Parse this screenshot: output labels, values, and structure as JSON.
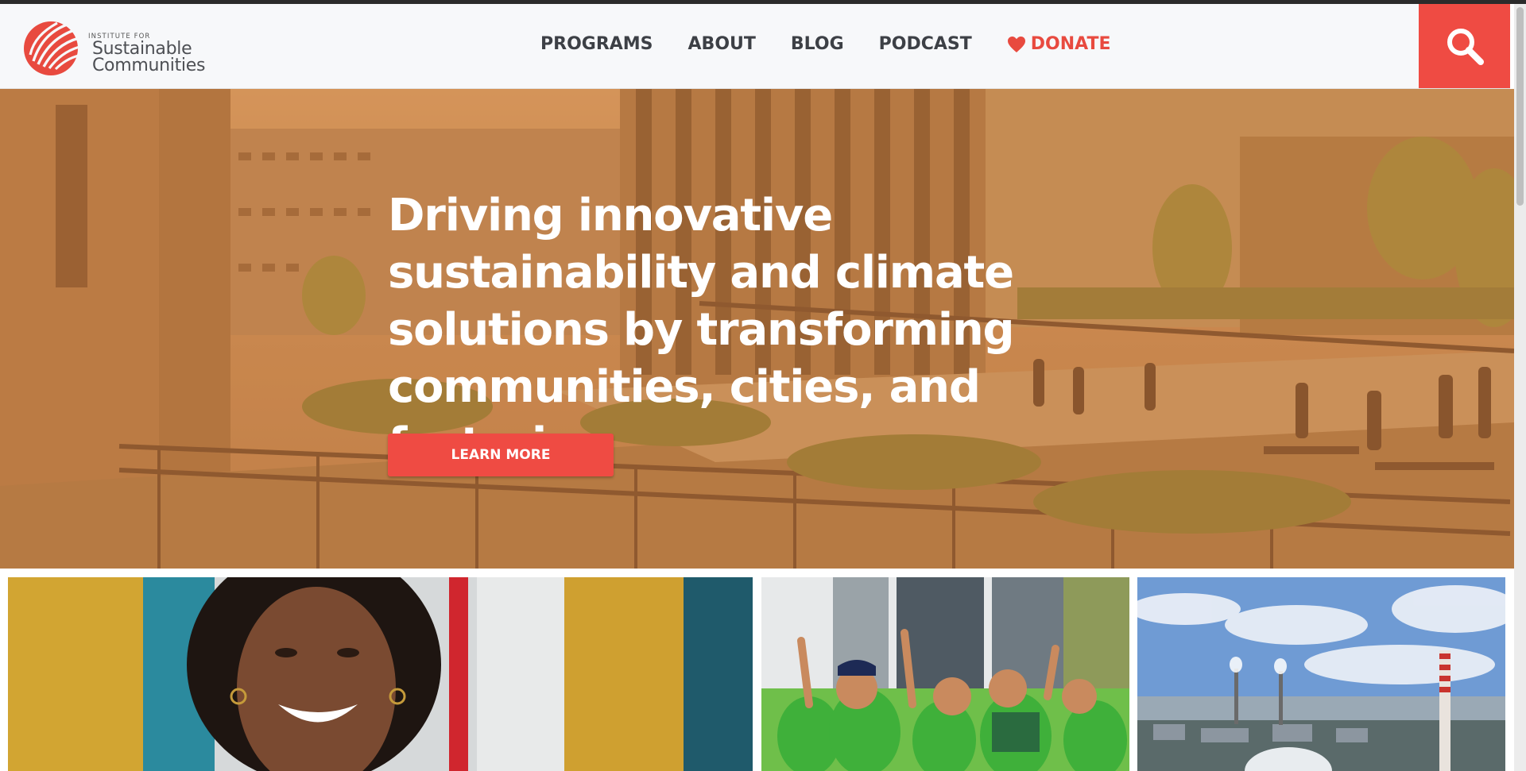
{
  "header": {
    "logo": {
      "small_text": "INSTITUTE FOR",
      "line1": "Sustainable",
      "line2": "Communities"
    },
    "nav": [
      {
        "label": "PROGRAMS"
      },
      {
        "label": "ABOUT"
      },
      {
        "label": "BLOG"
      },
      {
        "label": "PODCAST"
      },
      {
        "label": "DONATE",
        "icon": "heart-icon",
        "color": "#e84a3f"
      }
    ],
    "search_icon": "search-icon"
  },
  "hero": {
    "title": "Driving innovative sustainability and climate solutions by transforming communities, cities, and factories.",
    "button_label": "LEARN MORE"
  },
  "colors": {
    "accent": "#ef4b43",
    "nav_text": "#3d4046",
    "header_bg": "#f7f8fa"
  }
}
